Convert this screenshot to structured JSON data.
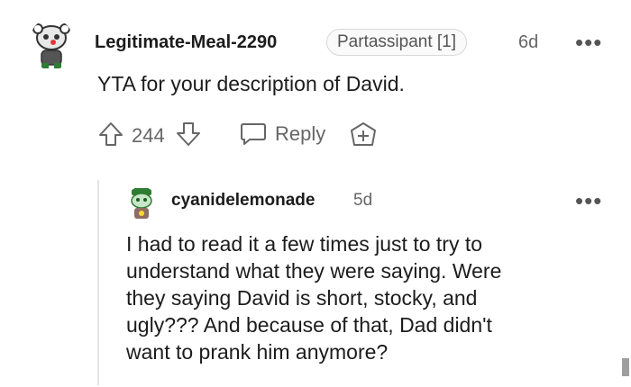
{
  "comment": {
    "username": "Legitimate-Meal-2290",
    "flair": "Partassipant [1]",
    "time": "6d",
    "more_label": "•••",
    "body": "YTA for your description of David.",
    "vote_count": "244",
    "reply_label": "Reply"
  },
  "reply": {
    "username": "cyanidelemonade",
    "time": "5d",
    "more_label": "•••",
    "body_lines": [
      "I had to read it a few times just to try to",
      "understand what they were saying. Were",
      "they saying David is short, stocky, and",
      "ugly??? And because of that, Dad didn't",
      "want to prank him anymore?"
    ]
  },
  "icons": [
    "reddit-avatar-icon",
    "upvote-icon",
    "downvote-icon",
    "reply-bubble-icon",
    "award-plus-icon",
    "snoo-avatar-icon"
  ],
  "colors": {
    "text": "#1c1c1c",
    "muted": "#666666",
    "border": "#d8d8d8"
  }
}
